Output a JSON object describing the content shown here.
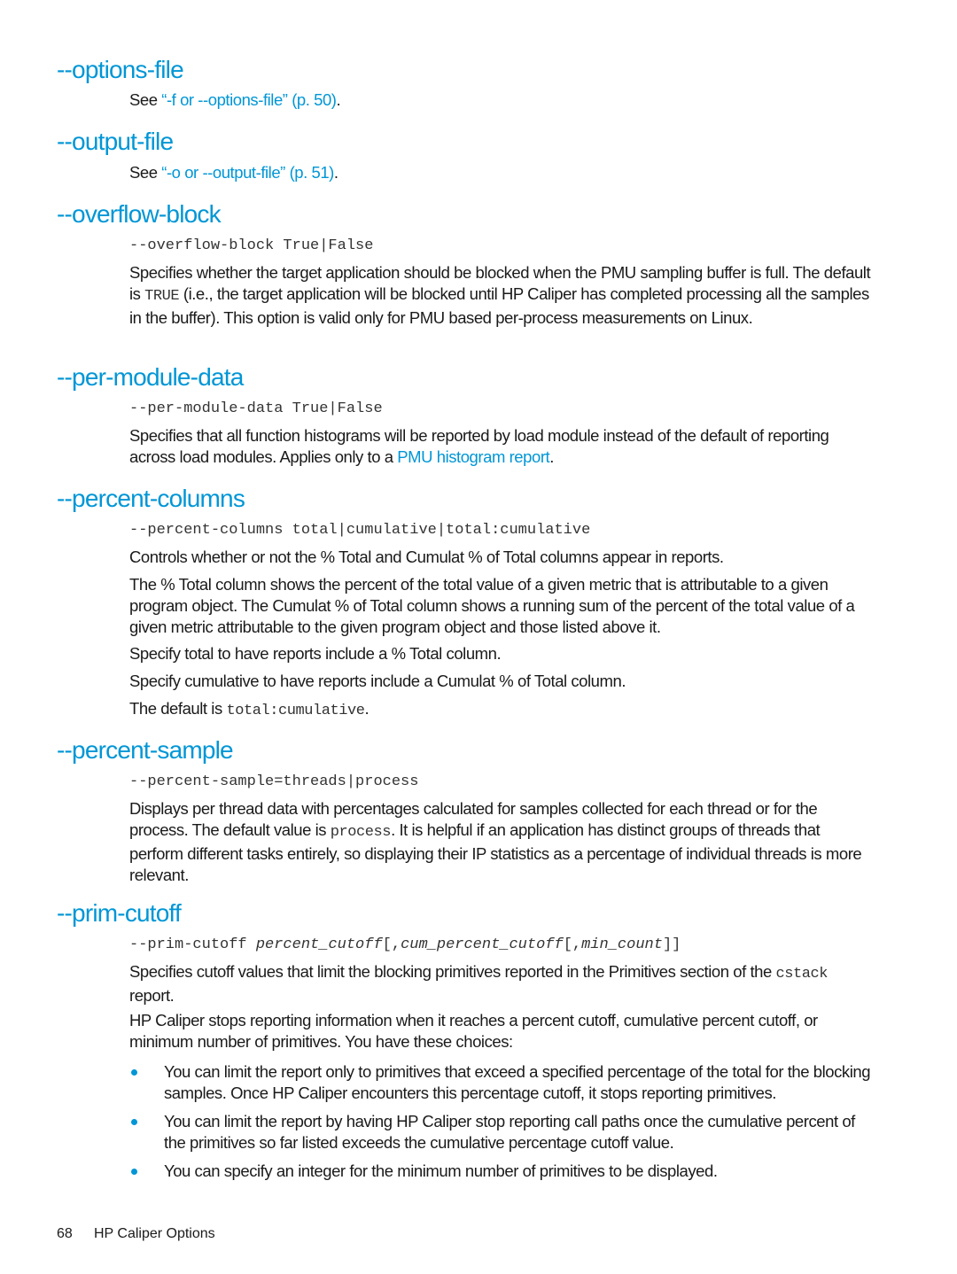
{
  "sections": [
    {
      "id": "options-file",
      "heading": "--options-file",
      "see_prefix": "See ",
      "see_link": "“-f or --options-file” (p. 50)",
      "see_suffix": "."
    },
    {
      "id": "output-file",
      "heading": "--output-file",
      "see_prefix": "See ",
      "see_link": "“-o or --output-file” (p. 51)",
      "see_suffix": "."
    },
    {
      "id": "overflow-block",
      "heading": "--overflow-block",
      "syntax": "--overflow-block True|False",
      "p1_a": "Specifies whether the target application should be blocked when the PMU sampling buffer is full. The default is ",
      "p1_code": "TRUE",
      "p1_b": " (i.e., the target application will be blocked until HP Caliper has completed processing all the samples in the buffer). This option is valid only for PMU based per-process measurements on Linux."
    },
    {
      "id": "per-module-data",
      "heading": "--per-module-data",
      "syntax": "--per-module-data True|False",
      "p1_a": "Specifies that all function histograms will be reported by load module instead of the default of reporting across load modules. Applies only to a ",
      "p1_link": "PMU histogram report",
      "p1_b": "."
    },
    {
      "id": "percent-columns",
      "heading": "--percent-columns",
      "syntax": "--percent-columns total|cumulative|total:cumulative",
      "p1": "Controls whether or not the % Total and Cumulat % of Total columns appear in reports.",
      "p2": "The % Total column shows the percent of the total value of a given metric that is attributable to a given program object. The Cumulat % of Total column shows a running sum of the percent of the total value of a given metric attributable to the given program object and those listed above it.",
      "p3": "Specify total to have reports include a % Total column.",
      "p4": "Specify cumulative to have reports include a Cumulat % of Total column.",
      "p5_a": "The default is ",
      "p5_code": "total:cumulative",
      "p5_b": "."
    },
    {
      "id": "percent-sample",
      "heading": "--percent-sample",
      "syntax": "--percent-sample=threads|process",
      "p1_a": "Displays per thread data with percentages calculated for samples collected for each thread or for the process. The default value is ",
      "p1_code": "process",
      "p1_b": ". It is helpful if an application has distinct groups of threads that perform different tasks entirely, so displaying their IP statistics as a percentage of individual threads is more relevant."
    },
    {
      "id": "prim-cutoff",
      "heading": "--prim-cutoff",
      "syntax_cmd": "--prim-cutoff ",
      "syntax_arg1": "percent_cutoff",
      "syntax_sep1": "[,",
      "syntax_arg2": "cum_percent_cutoff",
      "syntax_sep2": "[,",
      "syntax_arg3": "min_count",
      "syntax_end": "]]",
      "p1_a": "Specifies cutoff values that limit the blocking primitives reported in the Primitives section of the ",
      "p1_code": "cstack",
      "p1_b": " report.",
      "p2": "HP Caliper stops reporting information when it reaches a percent cutoff, cumulative percent cutoff, or minimum number of primitives. You have these choices:",
      "bullets": [
        "You can limit the report only to primitives that exceed a specified percentage of the total for the blocking samples. Once HP Caliper encounters this percentage cutoff, it stops reporting primitives.",
        "You can limit the report by having HP Caliper stop reporting call paths once the cumulative percent of the primitives so far listed exceeds the cumulative percentage cutoff value.",
        "You can specify an integer for the minimum number of primitives to be displayed."
      ]
    }
  ],
  "footer": {
    "page_number": "68",
    "chapter_title": "HP Caliper Options"
  },
  "colors": {
    "accent": "#0096d6",
    "text": "#1a1a1a",
    "code": "#333333"
  }
}
